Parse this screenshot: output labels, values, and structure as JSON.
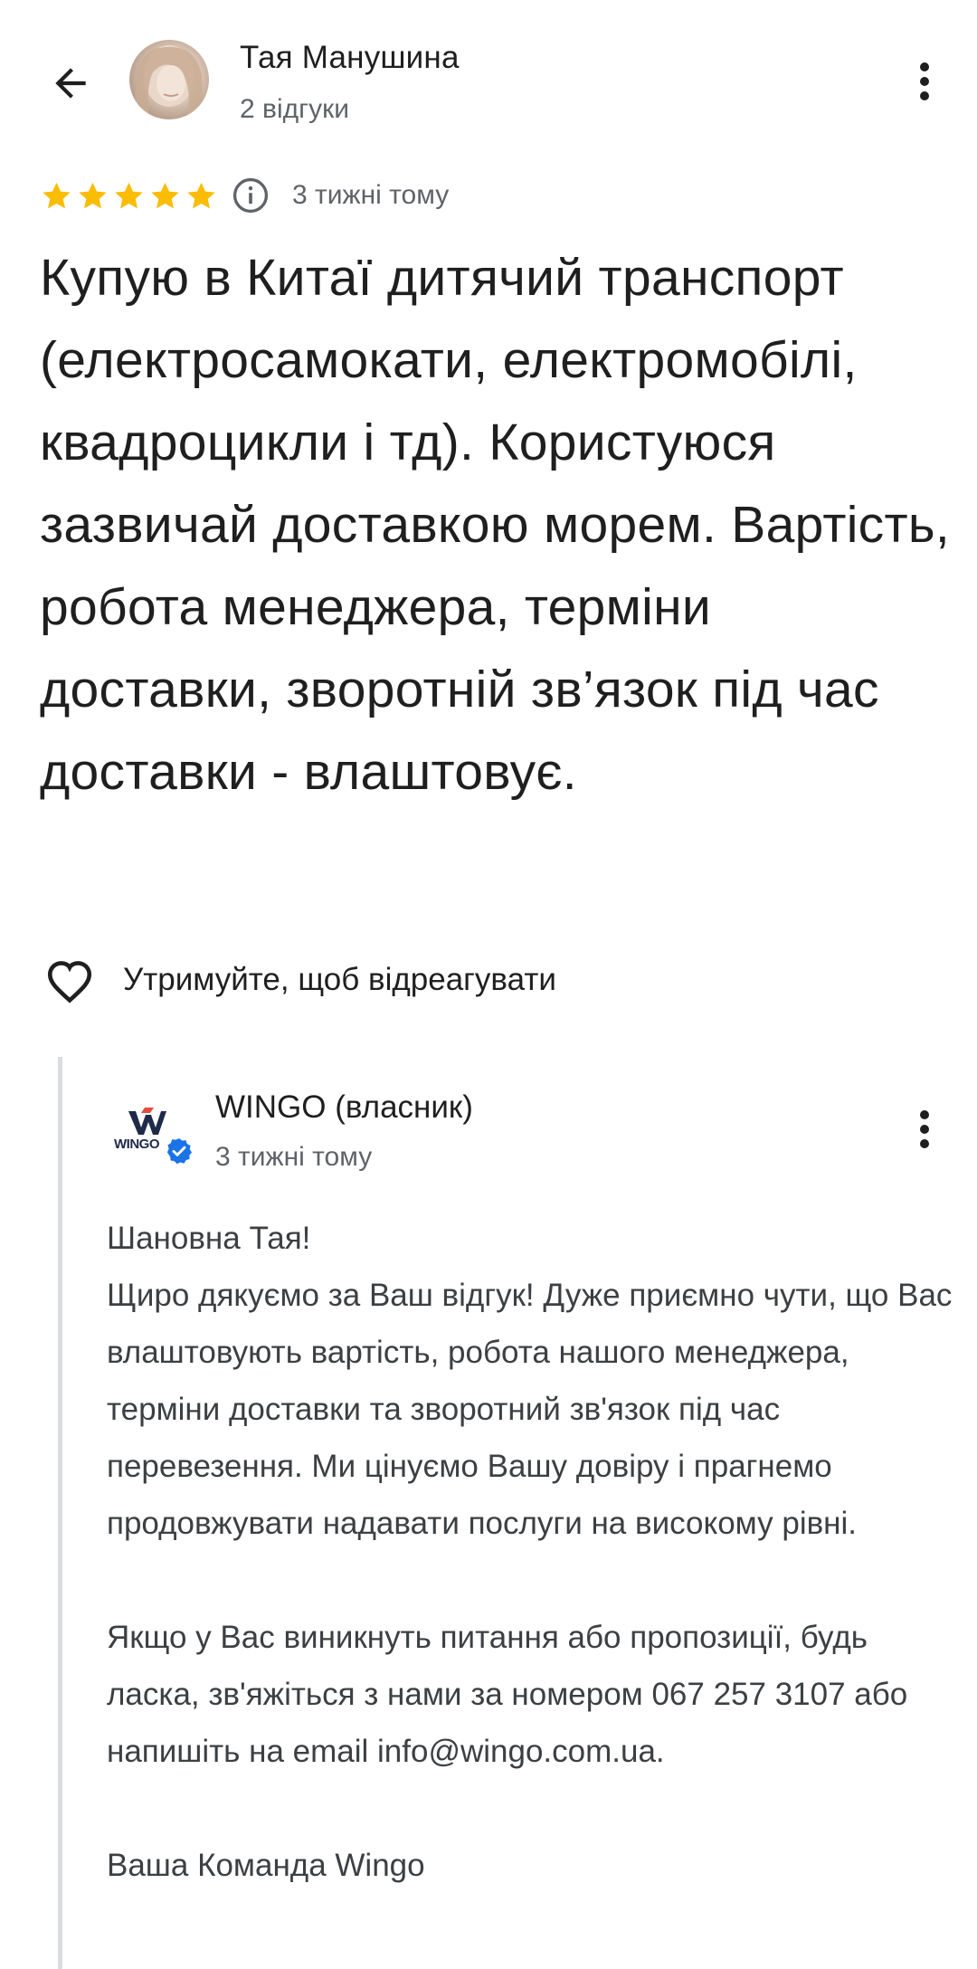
{
  "header": {
    "back_icon": "arrow-left-icon",
    "reviewer_name": "Тая Манушина",
    "reviewer_meta": "2 відгуки",
    "more_icon": "more-vert-icon"
  },
  "review": {
    "rating": 5,
    "rating_max": 5,
    "star_color": "#fbbc04",
    "info_icon": "info-icon",
    "date": "3 тижні тому",
    "text": "Купую в Китаї дитячий транспорт (електросамокати, електромобілі, квадроцикли і тд). Користуюся зазвичай доставкою морем. Вартість, робота менеджера, терміни доставки, зворотній зв’язок під час доставки - влаштовує.",
    "like_icon": "heart-outline-icon",
    "like_label": "Утримуйте, щоб відреагувати"
  },
  "owner_reply": {
    "logo_text": "WINGO",
    "verified_icon": "verified-badge-icon",
    "verified_color": "#1a73e8",
    "name": "WINGO (власник)",
    "date": "3 тижні тому",
    "more_icon": "more-vert-icon",
    "paragraphs": [
      "Шановна Тая!",
      "Щиро дякуємо за Ваш відгук! Дуже приємно чути, що Вас влаштовують вартість, робота нашого менеджера, терміни доставки та зворотний зв'язок під час перевезення. Ми цінуємо Вашу довіру і прагнемо продовжувати надавати послуги на високому рівні.",
      "Якщо у Вас виникнуть питання або пропозиції, будь ласка, зв'яжіться з нами за номером 067 257 3107 або напишіть на email info@wingo.com.ua.",
      "Ваша Команда Wingo"
    ]
  }
}
